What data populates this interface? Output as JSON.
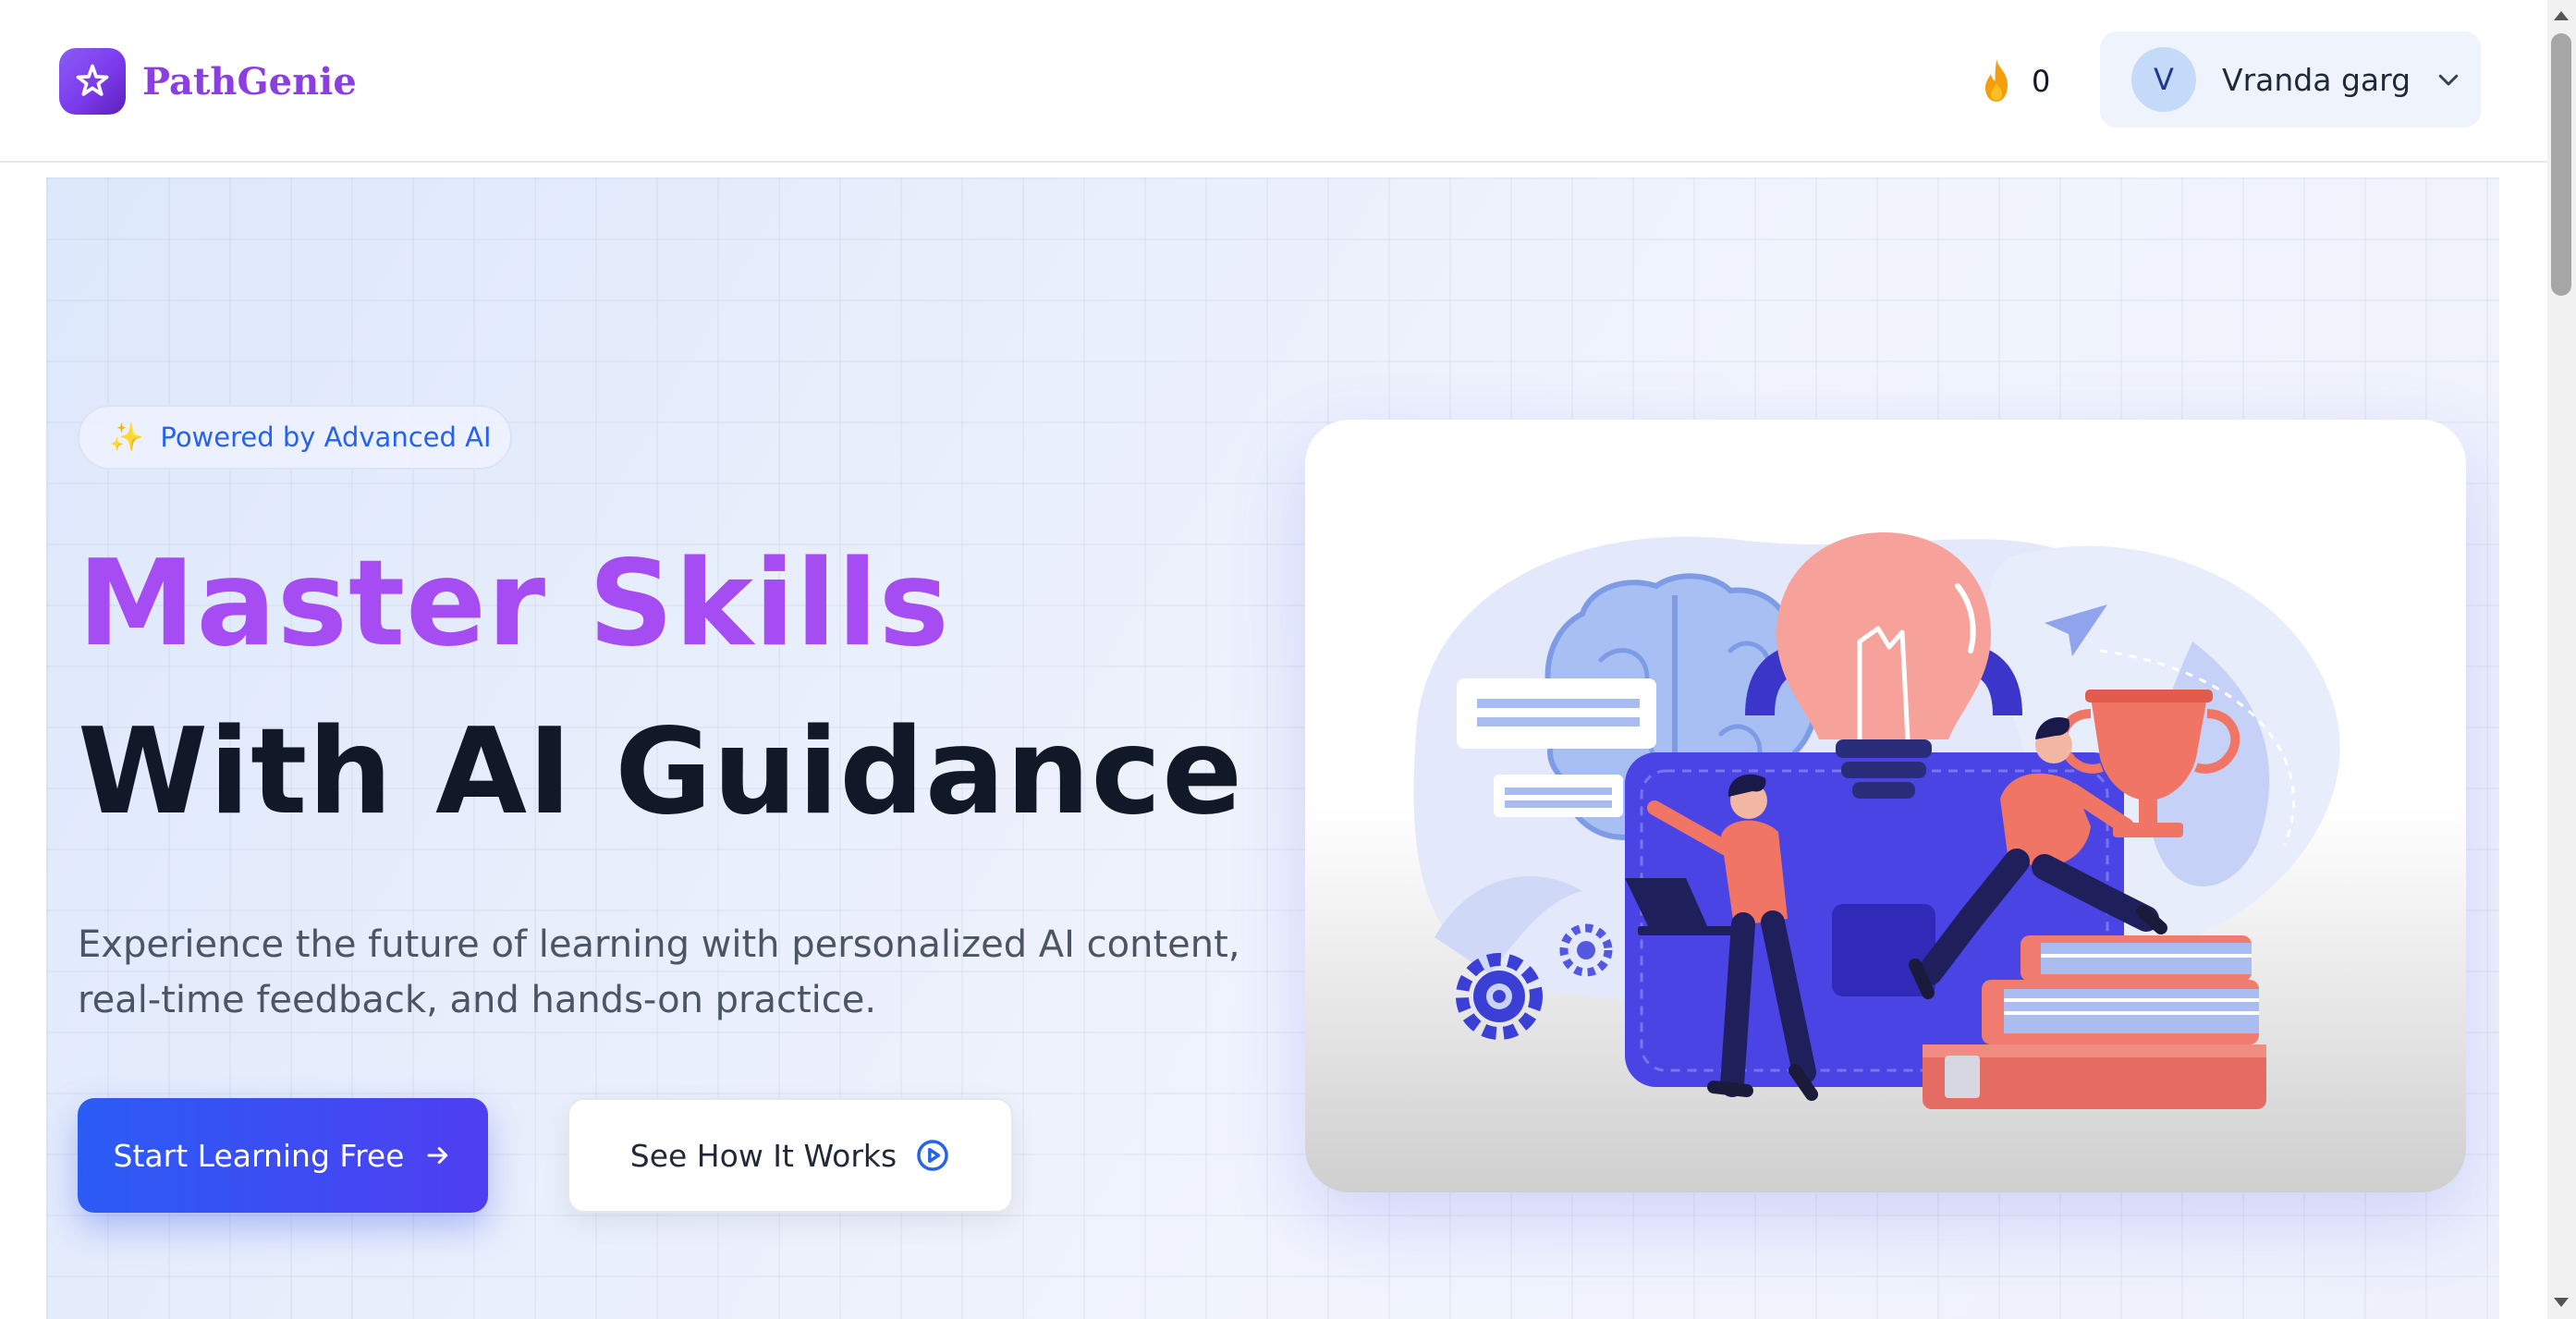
{
  "header": {
    "logo_text": "PathGenie",
    "streak_count": "0",
    "user": {
      "initial": "V",
      "name": "Vranda garg"
    }
  },
  "hero": {
    "badge": "Powered by Advanced AI",
    "title_line1": "Master Skills",
    "title_line2": "With AI Guidance",
    "subtitle": "Experience the future of learning with personalized AI content, real-time feedback, and hands-on practice.",
    "primary_cta": "Start Learning Free",
    "secondary_cta": "See How It Works"
  },
  "icons": {
    "logo": "sparkle-star-icon",
    "streak": "fire-icon",
    "badge": "sparkles-icon",
    "user_menu": "chevron-down-icon",
    "primary_cta": "arrow-right-icon",
    "secondary_cta": "play-circle-icon"
  },
  "colors": {
    "brand_purple": "#a54cf2",
    "primary_blue": "#2a5cf4",
    "heading_dark": "#111827",
    "badge_blue": "#2563eb"
  }
}
